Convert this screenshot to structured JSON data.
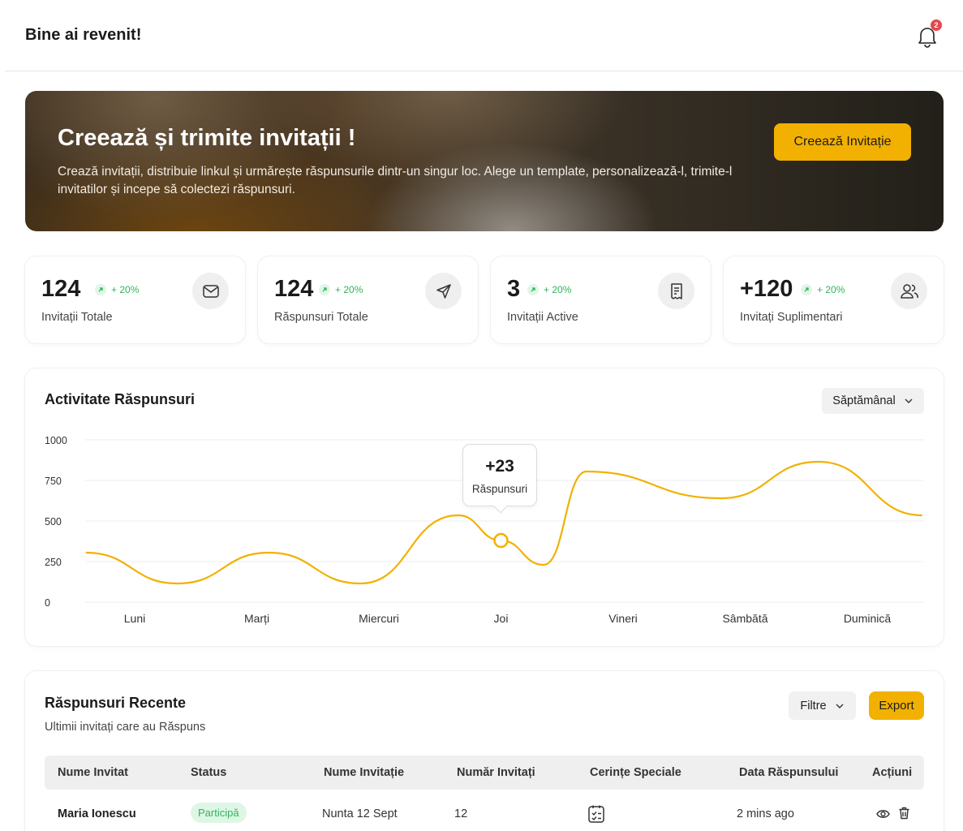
{
  "header": {
    "title": "Bine ai revenit!",
    "notification_count": "2"
  },
  "hero": {
    "title": "Creează și trimite invitații !",
    "description": "Crează invitații, distribuie linkul și urmărește răspunsurile dintr-un singur loc. Alege un template, personalizează-l, trimite-l invitatilor și incepe să colectezi răspunsuri.",
    "cta_label": "Creează Invitație"
  },
  "stats": [
    {
      "value": "124",
      "trend": "+ 20%",
      "label": "Invitații Totale",
      "icon": "mail-icon"
    },
    {
      "value": "124",
      "trend": "+ 20%",
      "label": "Răspunsuri Totale",
      "icon": "send-icon"
    },
    {
      "value": "3",
      "trend": "+ 20%",
      "label": "Invitații Active",
      "icon": "receipt-icon"
    },
    {
      "value": "+120",
      "trend": "+ 20%",
      "label": "Invitați Suplimentari",
      "icon": "users-icon"
    }
  ],
  "activity": {
    "title": "Activitate Răspunsuri",
    "period_label": "Săptămânal",
    "tooltip": {
      "value": "+23",
      "label": "Răspunsuri"
    }
  },
  "chart_data": {
    "type": "line",
    "title": "Activitate Răspunsuri",
    "categories": [
      "Luni",
      "Marți",
      "Miercuri",
      "Joi",
      "Vineri",
      "Sâmbătă",
      "Duminică"
    ],
    "y_ticks": [
      0,
      250,
      500,
      750,
      1000
    ],
    "ylim": [
      0,
      1000
    ],
    "series": [
      {
        "color": "#f2b100",
        "points": [
          [
            -0.4,
            305
          ],
          [
            0.35,
            115
          ],
          [
            1.1,
            305
          ],
          [
            1.85,
            115
          ],
          [
            2.65,
            535
          ],
          [
            3.0,
            380
          ],
          [
            3.35,
            230
          ],
          [
            3.7,
            805
          ],
          [
            4.8,
            640
          ],
          [
            5.6,
            865
          ],
          [
            6.45,
            535
          ]
        ]
      }
    ],
    "highlight": {
      "x": 3.0,
      "y": 380
    },
    "grid": true,
    "legend": "none"
  },
  "recent": {
    "title": "Răspunsuri Recente",
    "subtitle": "Ultimii invitați care au Răspuns",
    "filter_label": "Filtre",
    "export_label": "Export",
    "columns": [
      "Nume Invitat",
      "Status",
      "Nume Invitație",
      "Număr Invitați",
      "Cerințe Speciale",
      "Data Răspunsului",
      "Acțiuni"
    ],
    "rows": [
      {
        "name": "Maria Ionescu",
        "status": "Participă",
        "invitation": "Nunta 12 Sept",
        "count": "12",
        "special": "checklist-icon",
        "date": "2 mins ago"
      }
    ]
  }
}
